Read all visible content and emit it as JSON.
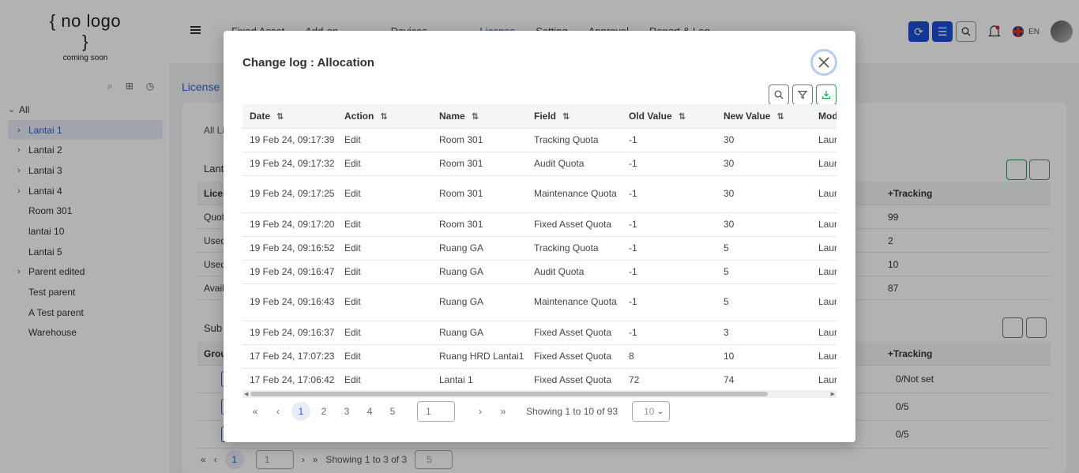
{
  "app": {
    "logo_main": "{ no logo }",
    "logo_sub": "coming soon",
    "nav": [
      "Fixed Asset",
      "Add-on",
      "Devices",
      "License",
      "Setting",
      "Approval",
      "Report & Log"
    ],
    "active_nav": "License",
    "lang": "EN"
  },
  "sidebar": {
    "items": [
      {
        "label": "All",
        "expandable": true,
        "level": 0
      },
      {
        "label": "Lantai 1",
        "expandable": true,
        "level": 1,
        "selected": true
      },
      {
        "label": "Lantai 2",
        "expandable": true,
        "level": 1
      },
      {
        "label": "Lantai 3",
        "expandable": true,
        "level": 1
      },
      {
        "label": "Lantai 4",
        "expandable": true,
        "level": 1
      },
      {
        "label": "Room 301",
        "expandable": false,
        "level": 1
      },
      {
        "label": "lantai 10",
        "expandable": false,
        "level": 1
      },
      {
        "label": "Lantai 5",
        "expandable": false,
        "level": 1
      },
      {
        "label": "Parent edited",
        "expandable": true,
        "level": 1
      },
      {
        "label": "Test parent",
        "expandable": false,
        "level": 1
      },
      {
        "label": "A Test parent",
        "expandable": false,
        "level": 1
      },
      {
        "label": "Warehouse",
        "expandable": false,
        "level": 1
      }
    ]
  },
  "background": {
    "breadcrumb": "License",
    "tab": "All Li",
    "section1": "Lant",
    "col_head1": "Licen",
    "col_tracking": "+Tracking",
    "rows": [
      {
        "label": "Quot",
        "value": "99"
      },
      {
        "label": "Used",
        "value": "2"
      },
      {
        "label": "Used",
        "value": "10"
      },
      {
        "label": "Avail",
        "value": "87"
      }
    ],
    "section2": "Sub",
    "col_head2": "Grou",
    "col_tracking2": "+Tracking",
    "sub_rows": [
      "0/Not set",
      "0/5",
      "0/5"
    ],
    "pager_page": "1",
    "pager_input": "1",
    "pager_showing": "Showing 1 to 3 of 3",
    "pager_size": "5"
  },
  "modal": {
    "title": "Change log : Allocation",
    "columns": [
      "Date",
      "Action",
      "Name",
      "Field",
      "Old Value",
      "New Value",
      "Mod"
    ],
    "rows": [
      {
        "date": "19 Feb 24, 09:17:39",
        "action": "Edit",
        "name": "Room 301",
        "field": "Tracking Quota",
        "old": "-1",
        "new": "30",
        "mod": "Laur"
      },
      {
        "date": "19 Feb 24, 09:17:32",
        "action": "Edit",
        "name": "Room 301",
        "field": "Audit Quota",
        "old": "-1",
        "new": "30",
        "mod": "Laur"
      },
      {
        "date": "19 Feb 24, 09:17:25",
        "action": "Edit",
        "name": "Room 301",
        "field": "Maintenance Quota",
        "old": "-1",
        "new": "30",
        "mod": "Laur"
      },
      {
        "date": "19 Feb 24, 09:17:20",
        "action": "Edit",
        "name": "Room 301",
        "field": "Fixed Asset Quota",
        "old": "-1",
        "new": "30",
        "mod": "Laur"
      },
      {
        "date": "19 Feb 24, 09:16:52",
        "action": "Edit",
        "name": "Ruang GA",
        "field": "Tracking Quota",
        "old": "-1",
        "new": "5",
        "mod": "Laur"
      },
      {
        "date": "19 Feb 24, 09:16:47",
        "action": "Edit",
        "name": "Ruang GA",
        "field": "Audit Quota",
        "old": "-1",
        "new": "5",
        "mod": "Laur"
      },
      {
        "date": "19 Feb 24, 09:16:43",
        "action": "Edit",
        "name": "Ruang GA",
        "field": "Maintenance Quota",
        "old": "-1",
        "new": "5",
        "mod": "Laur"
      },
      {
        "date": "19 Feb 24, 09:16:37",
        "action": "Edit",
        "name": "Ruang GA",
        "field": "Fixed Asset Quota",
        "old": "-1",
        "new": "3",
        "mod": "Laur"
      },
      {
        "date": "17 Feb 24, 17:07:23",
        "action": "Edit",
        "name": "Ruang HRD Lantai1",
        "field": "Fixed Asset Quota",
        "old": "8",
        "new": "10",
        "mod": "Laur"
      },
      {
        "date": "17 Feb 24, 17:06:42",
        "action": "Edit",
        "name": "Lantai 1",
        "field": "Fixed Asset Quota",
        "old": "72",
        "new": "74",
        "mod": "Laur"
      }
    ],
    "pager": {
      "pages": [
        "1",
        "2",
        "3",
        "4",
        "5"
      ],
      "current": "1",
      "input_placeholder": "1",
      "showing": "Showing 1 to 10 of 93",
      "page_size": "10"
    },
    "colors": {
      "accent": "#2f5fd0",
      "export_green": "#16a34a",
      "primary_button": "#1d4ed8"
    }
  }
}
